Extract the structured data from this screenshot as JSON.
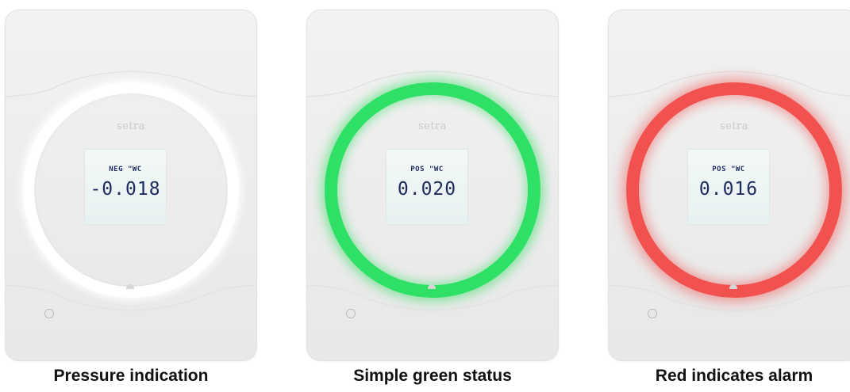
{
  "panels": [
    {
      "brand": "setra",
      "sign": "NEG",
      "unit": "\"WC",
      "value": "-0.018",
      "ring": "white",
      "ring_color": "#ffffff",
      "caption": "Pressure indication"
    },
    {
      "brand": "setra",
      "sign": "POS",
      "unit": "\"WC",
      "value": "0.020",
      "ring": "green",
      "ring_color": "#2fe066",
      "caption": "Simple green status"
    },
    {
      "brand": "setra",
      "sign": "POS",
      "unit": "\"WC",
      "value": "0.016",
      "ring": "red",
      "ring_color": "#f2524f",
      "caption": "Red indicates alarm"
    }
  ],
  "icons": {
    "sensor": "sensor-dots-icon"
  },
  "colors": {
    "display_text": "#1c2a5e",
    "background": "#ffffff"
  }
}
